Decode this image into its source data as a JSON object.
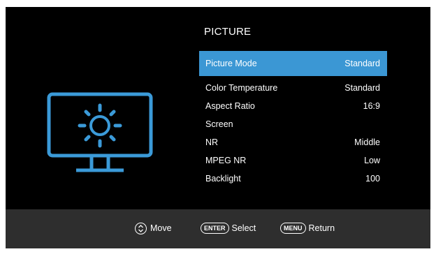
{
  "menu": {
    "title": "PICTURE",
    "items": [
      {
        "label": "Picture Mode",
        "value": "Standard",
        "selected": true
      },
      {
        "label": "Color Temperature",
        "value": "Standard"
      },
      {
        "label": "Aspect Ratio",
        "value": "16:9"
      },
      {
        "label": "Screen",
        "value": ""
      },
      {
        "label": "NR",
        "value": "Middle"
      },
      {
        "label": "MPEG NR",
        "value": "Low"
      },
      {
        "label": "Backlight",
        "value": "100"
      }
    ]
  },
  "footer": {
    "move_label": "Move",
    "enter_key": "ENTER",
    "select_label": "Select",
    "menu_key": "MENU",
    "return_label": "Return"
  },
  "icons": {
    "monitor": "monitor-sun-icon",
    "move": "updown-circle-icon"
  },
  "colors": {
    "background": "#000000",
    "highlight": "#3b97d4",
    "icon": "#3b9ad8",
    "footer": "#2e2e2e"
  }
}
